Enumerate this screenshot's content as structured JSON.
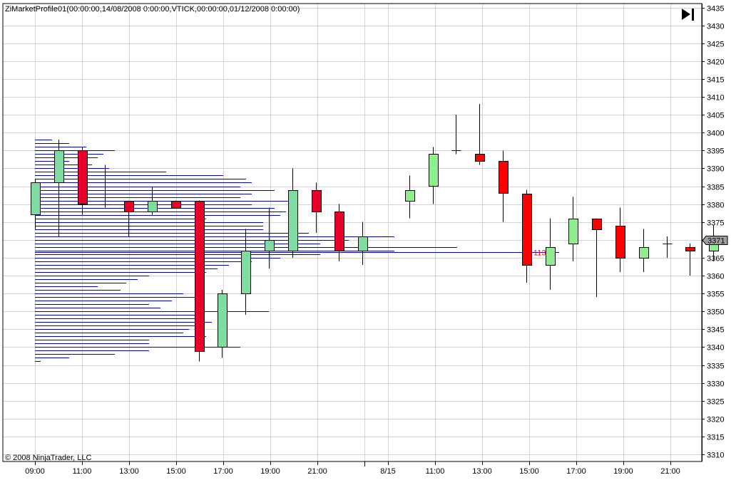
{
  "indicator_label": "ZiMarketProfile01(00:00:00,14/08/2008 0:00:00,VTICK,00:00:00,01/12/2008 0:00:00)",
  "copyright": "© 2008 NinjaTrader, LLC",
  "current_price_label": "3371",
  "icons": {
    "scroll_to_end": "skip-to-end-icon"
  },
  "colors": {
    "up_day1": "#7fdba0",
    "up_day2": "#90ee90",
    "down": "#ff0000",
    "down_day1": "#e8002a",
    "profile": "#0000b4",
    "poc_label": "#ff0000"
  },
  "chart_data": {
    "type": "candlestick",
    "ylim": [
      3308,
      3436
    ],
    "y_ticks": [
      3310,
      3315,
      3320,
      3325,
      3330,
      3335,
      3340,
      3345,
      3350,
      3355,
      3360,
      3365,
      3370,
      3375,
      3380,
      3385,
      3390,
      3395,
      3400,
      3405,
      3410,
      3415,
      3420,
      3425,
      3430,
      3435
    ],
    "x_labels": [
      "09:00",
      "11:00",
      "13:00",
      "15:00",
      "17:00",
      "19:00",
      "21:00",
      "8/15",
      "11:00",
      "13:00",
      "15:00",
      "17:00",
      "19:00",
      "21:00"
    ],
    "grid": true,
    "candles": [
      {
        "open": 3377,
        "high": 3387,
        "low": 3373,
        "close": 3386
      },
      {
        "open": 3386,
        "high": 3398,
        "low": 3371,
        "close": 3395
      },
      {
        "open": 3395,
        "high": 3396,
        "low": 3377,
        "close": 3380
      },
      {
        "open": 3380,
        "high": 3391,
        "low": 3379,
        "close": 3380
      },
      {
        "open": 3381,
        "high": 3381,
        "low": 3371,
        "close": 3378
      },
      {
        "open": 3378,
        "high": 3385,
        "low": 3377,
        "close": 3381
      },
      {
        "open": 3381,
        "high": 3381,
        "low": 3379,
        "close": 3379
      },
      {
        "open": 3381,
        "high": 3381,
        "low": 3336,
        "close": 3339
      },
      {
        "open": 3340,
        "high": 3356,
        "low": 3337,
        "close": 3355
      },
      {
        "open": 3355,
        "high": 3373,
        "low": 3349,
        "close": 3367
      },
      {
        "open": 3367,
        "high": 3379,
        "low": 3362,
        "close": 3370
      },
      {
        "open": 3367,
        "high": 3390,
        "low": 3365,
        "close": 3384
      },
      {
        "open": 3384,
        "high": 3386,
        "low": 3372,
        "close": 3378
      },
      {
        "open": 3378,
        "high": 3380,
        "low": 3364,
        "close": 3367
      },
      {
        "open": 3367,
        "high": 3375,
        "low": 3363,
        "close": 3371
      },
      {
        "open": 3371,
        "high": 3371,
        "low": 3371,
        "close": 3371
      },
      {
        "open": 3381,
        "high": 3388,
        "low": 3376,
        "close": 3384
      },
      {
        "open": 3385,
        "high": 3396,
        "low": 3380,
        "close": 3394
      },
      {
        "open": 3395,
        "high": 3405,
        "low": 3394,
        "close": 3395
      },
      {
        "open": 3394,
        "high": 3408,
        "low": 3391,
        "close": 3392
      },
      {
        "open": 3392,
        "high": 3395,
        "low": 3375,
        "close": 3383
      },
      {
        "open": 3383,
        "high": 3384,
        "low": 3358,
        "close": 3363
      },
      {
        "open": 3363,
        "high": 3376,
        "low": 3356,
        "close": 3368
      },
      {
        "open": 3369,
        "high": 3382,
        "low": 3364,
        "close": 3376
      },
      {
        "open": 3376,
        "high": 3376,
        "low": 3354,
        "close": 3373
      },
      {
        "open": 3374,
        "high": 3379,
        "low": 3361,
        "close": 3365
      },
      {
        "open": 3365,
        "high": 3373,
        "low": 3361,
        "close": 3368
      },
      {
        "open": 3369,
        "high": 3371,
        "low": 3365,
        "close": 3369
      },
      {
        "open": 3368,
        "high": 3369,
        "low": 3360,
        "close": 3367
      },
      {
        "open": 3367,
        "high": 3374,
        "low": 3364,
        "close": 3371
      }
    ],
    "profile_levels": [
      {
        "price": 3398,
        "extent": 1.5
      },
      {
        "price": 3397,
        "extent": 3.0
      },
      {
        "price": 3396,
        "extent": 4.5
      },
      {
        "price": 3395,
        "extent": 7.0
      },
      {
        "price": 3394,
        "extent": 6.0
      },
      {
        "price": 3393,
        "extent": 5.5
      },
      {
        "price": 3392,
        "extent": 3.0
      },
      {
        "price": 3391,
        "extent": 5.0
      },
      {
        "price": 3390,
        "extent": 6.5
      },
      {
        "price": 3389,
        "extent": 11.5
      },
      {
        "price": 3388,
        "extent": 16.5
      },
      {
        "price": 3387,
        "extent": 18.5
      },
      {
        "price": 3386,
        "extent": 19.0
      },
      {
        "price": 3385,
        "extent": 18.0
      },
      {
        "price": 3384,
        "extent": 21.0
      },
      {
        "price": 3383,
        "extent": 19.0
      },
      {
        "price": 3382,
        "extent": 18.0
      },
      {
        "price": 3381,
        "extent": 23.0
      },
      {
        "price": 3380,
        "extent": 19.0
      },
      {
        "price": 3379,
        "extent": 21.0
      },
      {
        "price": 3378,
        "extent": 22.0
      },
      {
        "price": 3377,
        "extent": 21.5
      },
      {
        "price": 3376,
        "extent": 15.0
      },
      {
        "price": 3375,
        "extent": 20.0
      },
      {
        "price": 3374,
        "extent": 20.0
      },
      {
        "price": 3373,
        "extent": 20.0
      },
      {
        "price": 3372,
        "extent": 24.0
      },
      {
        "price": 3371,
        "extent": 31.5
      },
      {
        "price": 3370,
        "extent": 27.5
      },
      {
        "price": 3369,
        "extent": 25.0
      },
      {
        "price": 3368,
        "extent": 37.0
      },
      {
        "price": 3367,
        "extent": 31.5
      },
      {
        "price": 3366,
        "extent": 25.0
      },
      {
        "price": 3365,
        "extent": 21.5
      },
      {
        "price": 3364,
        "extent": 19.0
      },
      {
        "price": 3363,
        "extent": 17.0
      },
      {
        "price": 3362,
        "extent": 16.0
      },
      {
        "price": 3361,
        "extent": 15.0
      },
      {
        "price": 3360,
        "extent": 10.0
      },
      {
        "price": 3359,
        "extent": 9.0
      },
      {
        "price": 3358,
        "extent": 8.0
      },
      {
        "price": 3357,
        "extent": 5.5
      },
      {
        "price": 3356,
        "extent": 7.5
      },
      {
        "price": 3355,
        "extent": 13.0
      },
      {
        "price": 3354,
        "extent": 14.0
      },
      {
        "price": 3353,
        "extent": 12.0
      },
      {
        "price": 3352,
        "extent": 10.0
      },
      {
        "price": 3351,
        "extent": 11.0
      },
      {
        "price": 3350,
        "extent": 20.5
      },
      {
        "price": 3349,
        "extent": 14.5
      },
      {
        "price": 3348,
        "extent": 14.0
      },
      {
        "price": 3347,
        "extent": 15.5
      },
      {
        "price": 3346,
        "extent": 14.0
      },
      {
        "price": 3345,
        "extent": 13.5
      },
      {
        "price": 3344,
        "extent": 13.0
      },
      {
        "price": 3343,
        "extent": 15.0
      },
      {
        "price": 3342,
        "extent": 10.0
      },
      {
        "price": 3341,
        "extent": 10.0
      },
      {
        "price": 3340,
        "extent": 18.0
      },
      {
        "price": 3339,
        "extent": 10.0
      },
      {
        "price": 3338,
        "extent": 7.0
      },
      {
        "price": 3337,
        "extent": 3.0
      },
      {
        "price": 3336,
        "extent": 0.5
      }
    ],
    "poc": {
      "price": 3368,
      "extent": 37.0,
      "label": "1133"
    }
  }
}
